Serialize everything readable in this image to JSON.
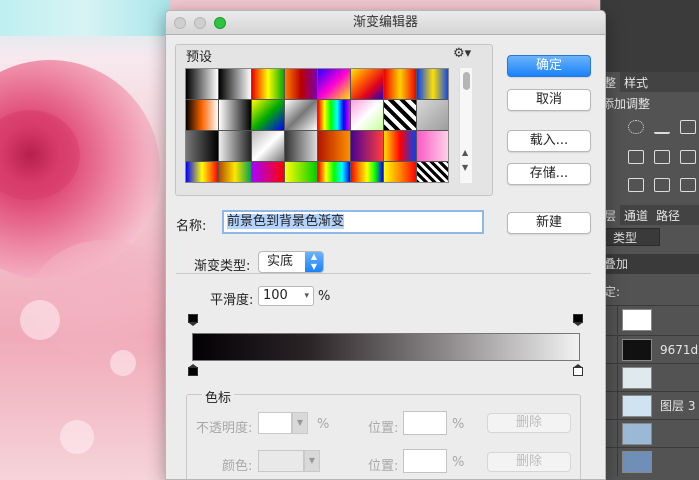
{
  "dialog": {
    "title": "渐变编辑器",
    "presets_label": "预设",
    "buttons": {
      "ok": "确定",
      "cancel": "取消",
      "load": "载入...",
      "save": "存储...",
      "new": "新建"
    },
    "name_label": "名称:",
    "name_value": "前景色到背景色渐变",
    "gradient_type_label": "渐变类型:",
    "gradient_type_value": "实底",
    "smoothness_label": "平滑度:",
    "smoothness_value": "100",
    "smoothness_unit": "%",
    "color_stops": {
      "title": "色标",
      "opacity_label": "不透明度:",
      "opacity_unit": "%",
      "color_label": "颜色:",
      "location_label": "位置:",
      "location_unit": "%",
      "delete_label": "删除"
    },
    "swatches": [
      "linear-gradient(90deg,#000,#fff)",
      "linear-gradient(90deg,#000,#fff)",
      "linear-gradient(90deg,#e00,#ff0,#0a0)",
      "linear-gradient(90deg,#ff7f00,#b00,#7a00aa)",
      "linear-gradient(135deg,#2a00ff,#ff00d4,#ffe600)",
      "linear-gradient(135deg,#ffe600,#ff6a00,#e1001b,#2200cc)",
      "linear-gradient(90deg,#e00,#ffd200,#e00)",
      "linear-gradient(90deg,#003cff,#ffe000,#003cff)",
      "linear-gradient(90deg,#000,#ff6600,#fff)",
      "linear-gradient(90deg,#fff,#000)",
      "linear-gradient(135deg,#ff0,#0a0,#00f)",
      "linear-gradient(135deg,#fff,#777,#fff)",
      "linear-gradient(90deg,#f00,#ff0,#0f0,#0ff,#00f,#f0f)",
      "linear-gradient(135deg,#ff9de0,#fff,#c6ff9a)",
      "repeating-linear-gradient(45deg,#000 0 4px,#fff 4px 8px)",
      "linear-gradient(135deg,#d8d8d8,#9c9c9c)",
      "linear-gradient(90deg,#777,#000)",
      "linear-gradient(90deg,#eee,#222)",
      "linear-gradient(135deg,#bbb,#fff,#777)",
      "linear-gradient(90deg,#333,#ddd)",
      "linear-gradient(90deg,#b31500,#ff9000)",
      "linear-gradient(90deg,#4a0094,#ff3d3d)",
      "linear-gradient(90deg,#ffe000,#f00,#0040ff)",
      "linear-gradient(90deg,#ff58c5,#ffd6ea)",
      "linear-gradient(90deg,#0000ff,#ff0,#f00)",
      "linear-gradient(90deg,#b64a00,#ffe600,#00a44b)",
      "linear-gradient(90deg,#a0f,#f00)",
      "linear-gradient(90deg,#ff0,#0c0)",
      "linear-gradient(90deg,#f00,#ff0,#0f0,#0ff,#00f)",
      "linear-gradient(90deg,#f00,#f80,#ff0,#0f0,#00f)",
      "linear-gradient(90deg,#ff0,#f80,#f00)",
      "repeating-linear-gradient(45deg,#000 0 3px,#fff 3px 6px)"
    ]
  },
  "photoshop": {
    "tab_adjustments": "整",
    "tab_styles": "样式",
    "adjustments_title": "添加调整",
    "tab_layers": "层",
    "tab_channels": "通道",
    "tab_paths": "路径",
    "filter_label": "类型",
    "blend_mode": "叠加",
    "lock_label": "定:",
    "layers": [
      "9671d",
      "图层 3"
    ]
  }
}
